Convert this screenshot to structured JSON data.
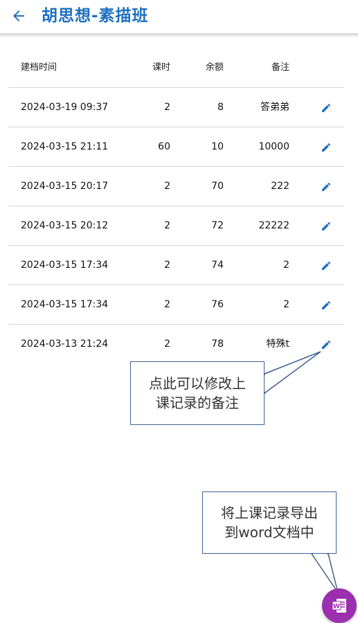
{
  "header": {
    "title": "胡思想-素描班",
    "back_icon": "arrow-left-icon"
  },
  "table": {
    "columns": [
      "建档时间",
      "课时",
      "余额",
      "备注"
    ],
    "rows": [
      {
        "date": "2024-03-19 09:37",
        "hours": "2",
        "balance": "8",
        "note": "答弟弟"
      },
      {
        "date": "2024-03-15 21:11",
        "hours": "60",
        "balance": "10",
        "note": "10000"
      },
      {
        "date": "2024-03-15 20:17",
        "hours": "2",
        "balance": "70",
        "note": "222"
      },
      {
        "date": "2024-03-15 20:12",
        "hours": "2",
        "balance": "72",
        "note": "22222"
      },
      {
        "date": "2024-03-15 17:34",
        "hours": "2",
        "balance": "74",
        "note": "2"
      },
      {
        "date": "2024-03-15 17:34",
        "hours": "2",
        "balance": "76",
        "note": "2"
      },
      {
        "date": "2024-03-13 21:24",
        "hours": "2",
        "balance": "78",
        "note": "特殊t"
      }
    ]
  },
  "callouts": {
    "edit_tip_line1": "点此可以修改上",
    "edit_tip_line2": "课记录的备注",
    "export_tip_line1": "将上课记录导出",
    "export_tip_line2": "到word文档中"
  },
  "fab": {
    "icon": "word-document-icon",
    "letter": "W"
  },
  "colors": {
    "accent": "#1f6fc0",
    "fab": "#9b2fae",
    "callout_border": "#3f5f8f"
  }
}
